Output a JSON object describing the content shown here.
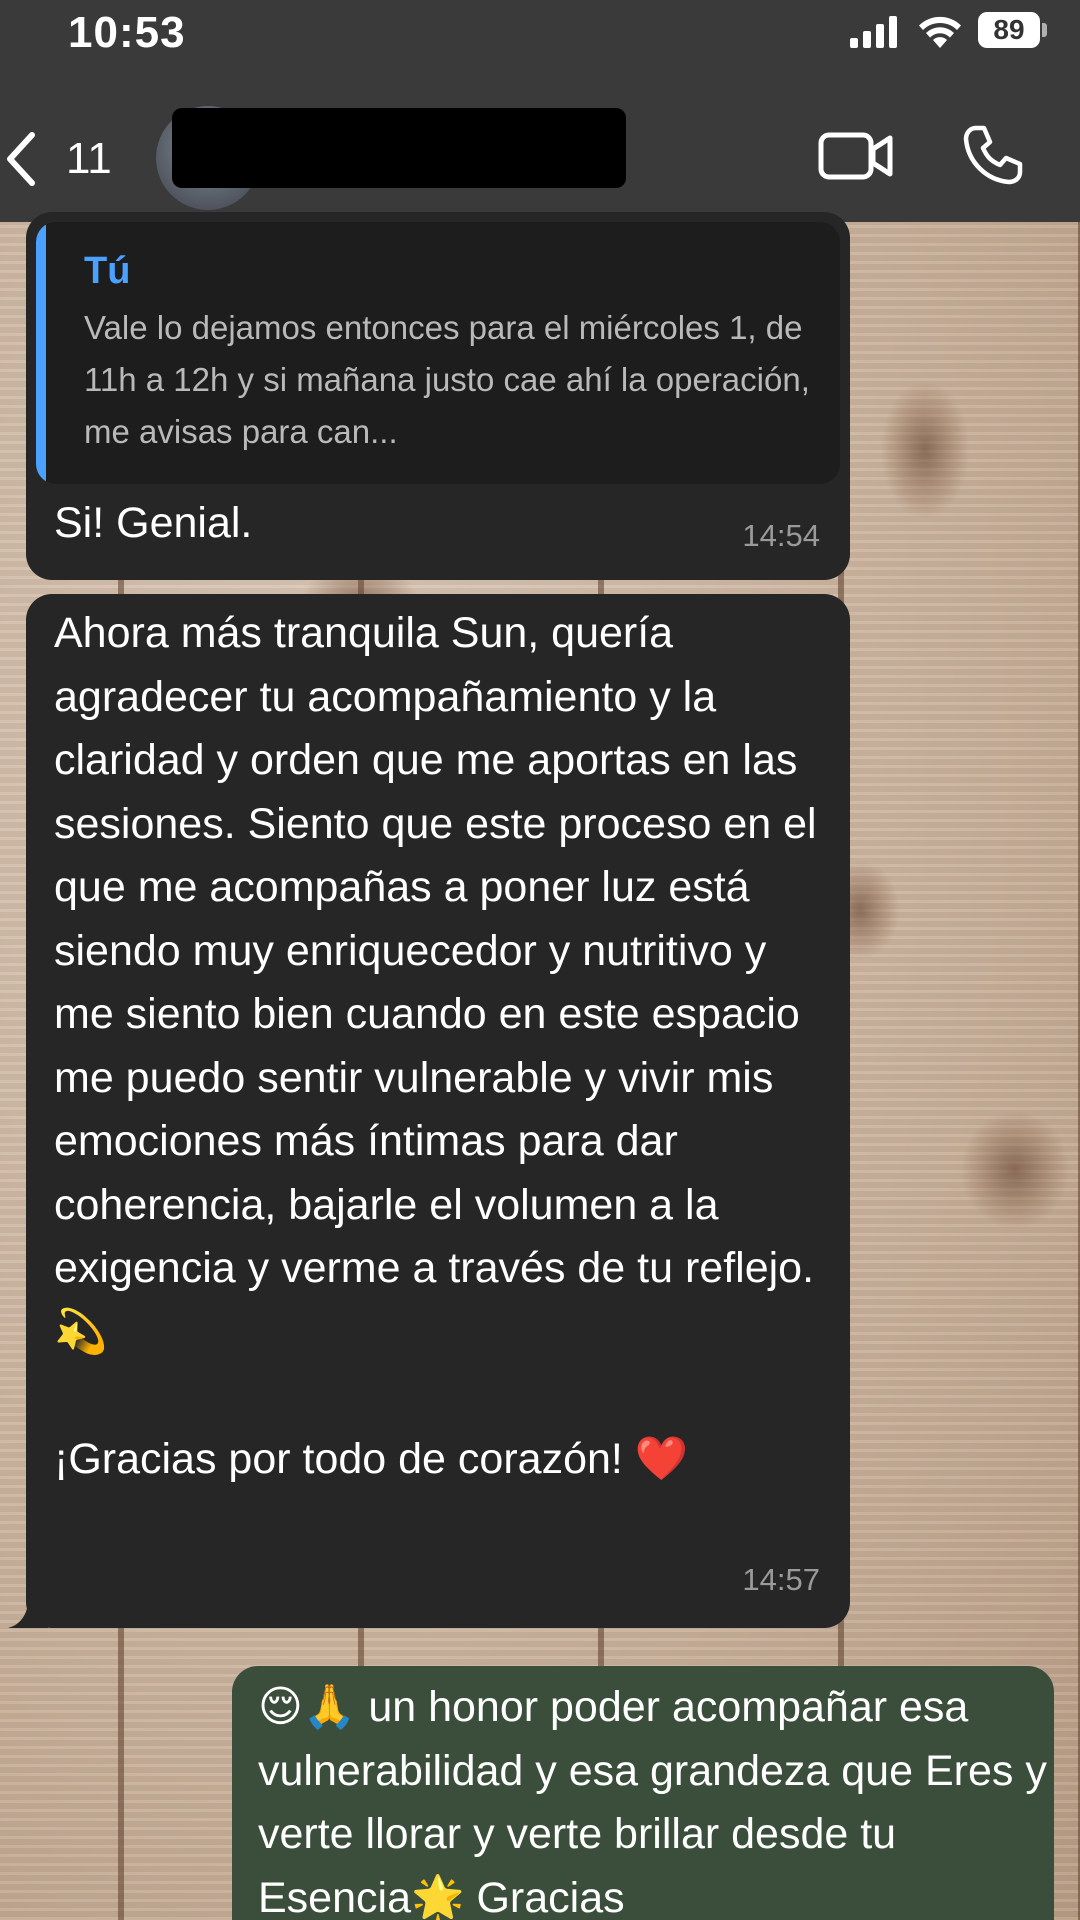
{
  "status_bar": {
    "time": "10:53",
    "battery": "89"
  },
  "header": {
    "back_count": "11",
    "icons": [
      "chevron-left-icon",
      "video-camera-icon",
      "phone-icon"
    ]
  },
  "messages": [
    {
      "direction": "incoming",
      "quote": {
        "author": "Tú",
        "text": "Vale lo dejamos entonces para el miércoles 1, de 11h a 12h y si mañana justo cae ahí la operación, me avisas para can..."
      },
      "text": "Si! Genial.",
      "time": "14:54"
    },
    {
      "direction": "incoming",
      "text": "Ahora más tranquila Sun, quería agradecer tu acompañamiento y la claridad y orden que me aportas en las sesiones. Siento que este proceso en el que me acompañas a poner luz está siendo muy enriquecedor y nutritivo y me siento bien cuando en este espacio me puedo sentir vulnerable y vivir mis emociones más íntimas para dar coherencia, bajarle el volumen a la exigencia y verme a través de tu reflejo. 💫\n\n¡Gracias por todo de corazón! ❤️",
      "time": "14:57"
    },
    {
      "direction": "outgoing",
      "text": "😌🙏 un honor poder acompañar esa vulnerabilidad y esa grandeza que Eres y verte llorar y verte brillar desde tu Esencia🌟 Gracias"
    }
  ],
  "colors": {
    "header_bg": "#3a3a3a",
    "incoming_bubble": "#262626",
    "outgoing_bubble": "#3a4e3b",
    "quote_accent": "#4aa1ff",
    "timestamp": "#9a9a9a"
  }
}
